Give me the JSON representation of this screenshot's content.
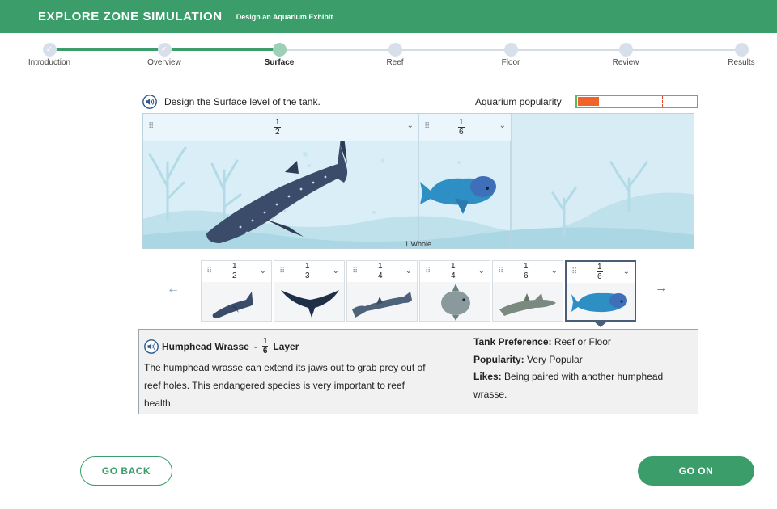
{
  "header": {
    "title": "EXPLORE ZONE SIMULATION",
    "subtitle": "Design an Aquarium Exhibit",
    "bg_color": "#3a9d6a"
  },
  "stepper": {
    "steps": [
      {
        "label": "Introduction",
        "state": "done"
      },
      {
        "label": "Overview",
        "state": "done"
      },
      {
        "label": "Surface",
        "state": "current"
      },
      {
        "label": "Reef",
        "state": "todo"
      },
      {
        "label": "Floor",
        "state": "todo"
      },
      {
        "label": "Review",
        "state": "todo"
      },
      {
        "label": "Results",
        "state": "todo"
      }
    ],
    "check_glyph": "✓"
  },
  "prompt": {
    "text": "Design the Surface level of the tank.",
    "audio_icon": "speaker-icon"
  },
  "popularity": {
    "label": "Aquarium popularity",
    "level": 0.18,
    "target": 0.72,
    "fill_color": "#f0642c",
    "border_color": "#5cb85c"
  },
  "tank": {
    "whole_label": "1 Whole",
    "slots": [
      {
        "num": "1",
        "den": "2",
        "fish": "whale shark"
      },
      {
        "num": "1",
        "den": "6",
        "fish": "humphead wrasse"
      }
    ],
    "filled_fraction": "2/3"
  },
  "cards": [
    {
      "num": "1",
      "den": "2",
      "fish": "whale shark"
    },
    {
      "num": "1",
      "den": "3",
      "fish": "manta ray"
    },
    {
      "num": "1",
      "den": "4",
      "fish": "hammerhead shark"
    },
    {
      "num": "1",
      "den": "4",
      "fish": "ocean sunfish"
    },
    {
      "num": "1",
      "den": "6",
      "fish": "shark"
    },
    {
      "num": "1",
      "den": "6",
      "fish": "humphead wrasse",
      "selected": true
    }
  ],
  "nav": {
    "prev_glyph": "←",
    "next_glyph": "→"
  },
  "info": {
    "name": "Humphead Wrasse",
    "dash": "-",
    "frac_num": "1",
    "frac_den": "6",
    "layer_word": "Layer",
    "description": "The humphead wrasse can extend its jaws out to grab prey out of reef holes. This endangered species is very important to reef health.",
    "pref_label": "Tank Preference:",
    "pref_value": "Reef or Floor",
    "pop_label": "Popularity:",
    "pop_value": "Very Popular",
    "likes_label": "Likes:",
    "likes_value": "Being paired with another humphead wrasse."
  },
  "buttons": {
    "back": "GO BACK",
    "next": "GO ON"
  },
  "glyphs": {
    "grip": "⠿",
    "chevron": "⌄"
  }
}
